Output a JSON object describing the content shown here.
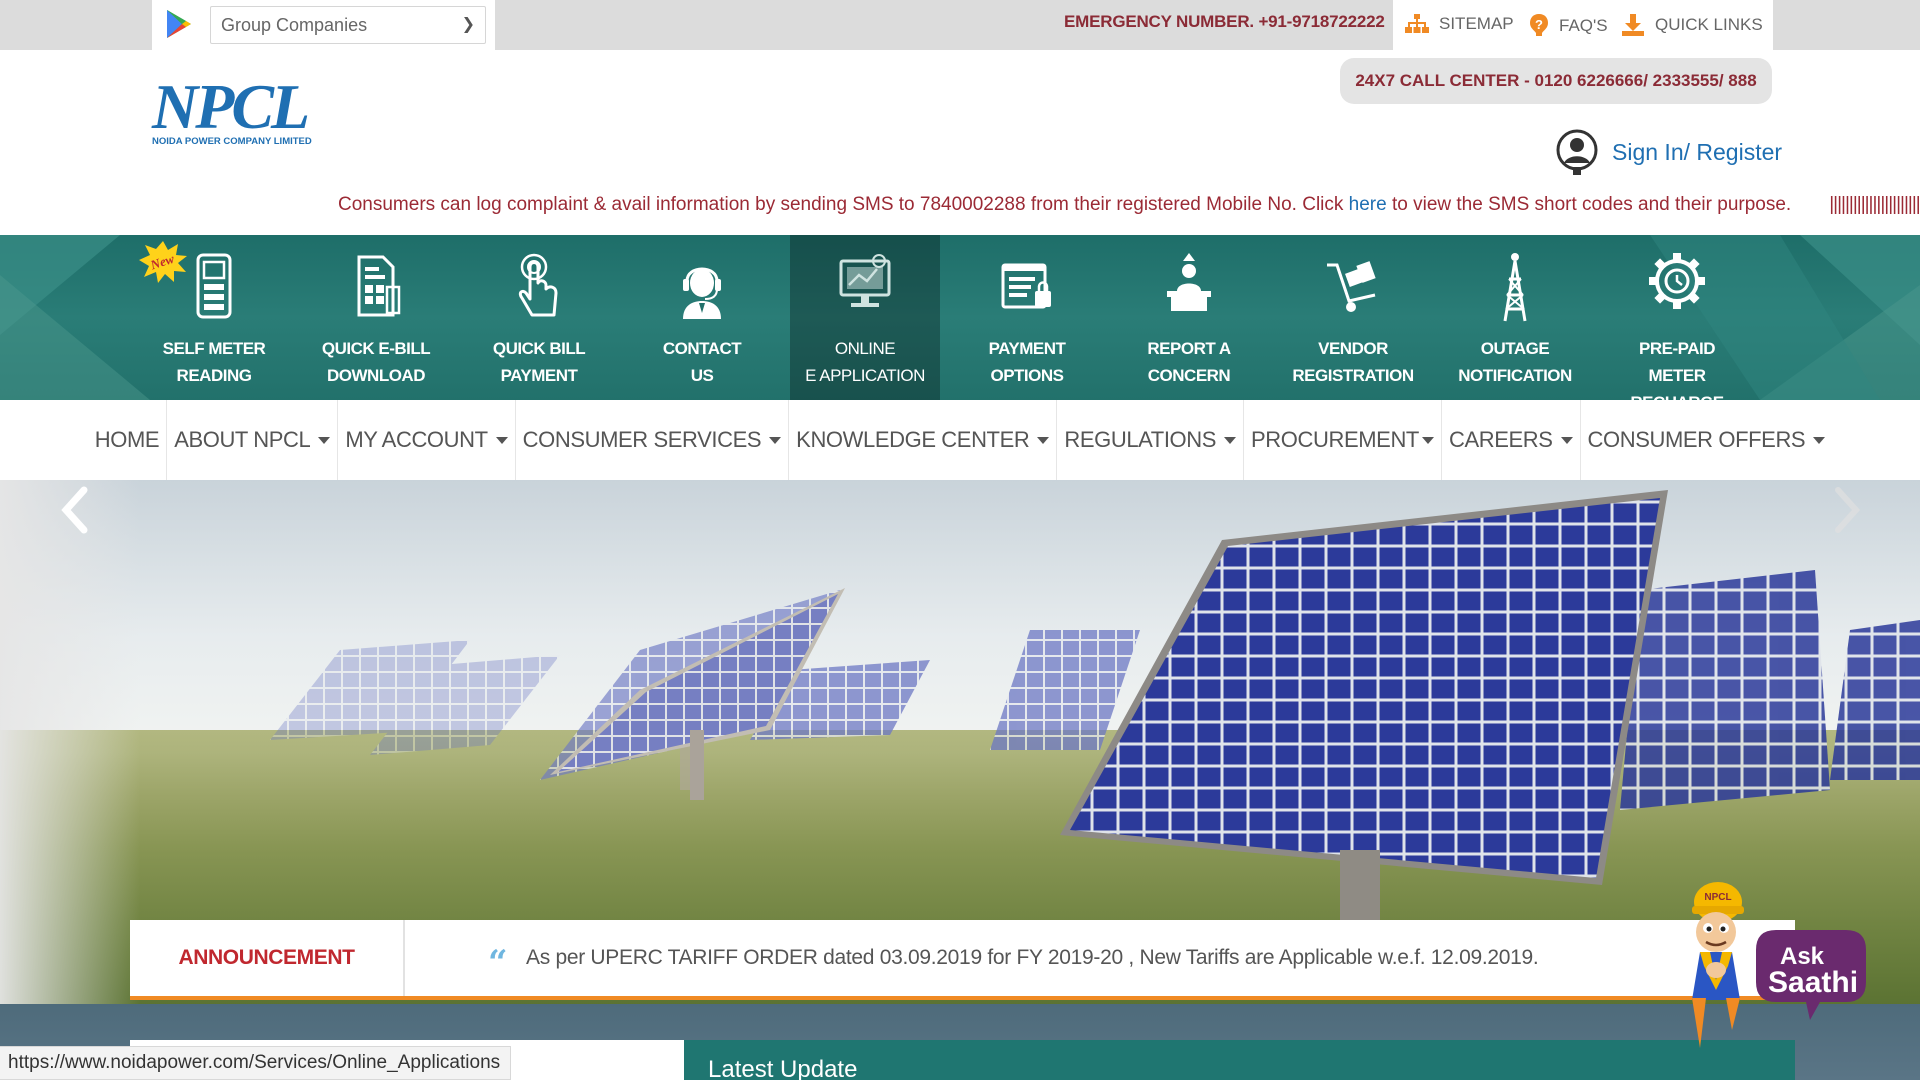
{
  "topbar": {
    "group_select": "Group Companies",
    "emergency": "EMERGENCY NUMBER. +91-9718722222",
    "links": [
      {
        "label": "SITEMAP",
        "icon": "sitemap-icon"
      },
      {
        "label": "FAQ'S",
        "icon": "faq-icon"
      },
      {
        "label": "QUICK LINKS",
        "icon": "download-icon"
      }
    ]
  },
  "header": {
    "logo_text": "NPCL",
    "logo_sub": "NOIDA POWER COMPANY LIMITED",
    "call_center": "24X7 CALL CENTER - 0120 6226666/ 2333555/ 888",
    "signin": "Sign In/ Register",
    "marquee_before": "Consumers can log complaint & avail information by sending SMS to 7840002288 from their registered Mobile No. Click ",
    "marquee_link": "here",
    "marquee_after": " to view the SMS short codes and their purpose.",
    "marquee_bars": "||||||||||||||||||||||||||||||||||||"
  },
  "quick_links": [
    {
      "line1": "SELF METER",
      "line2": "READING",
      "icon": "meter-icon"
    },
    {
      "line1": "QUICK E-BILL",
      "line2": "DOWNLOAD",
      "icon": "ebill-icon"
    },
    {
      "line1": "QUICK BILL",
      "line2": "PAYMENT",
      "icon": "hand-pointer-icon"
    },
    {
      "line1": "CONTACT",
      "line2": "US",
      "icon": "support-agent-icon"
    },
    {
      "line1": "ONLINE",
      "line2": "E APPLICATION",
      "icon": "monitor-icon"
    },
    {
      "line1": "PAYMENT",
      "line2": "OPTIONS",
      "icon": "payment-form-icon"
    },
    {
      "line1": "REPORT A",
      "line2": "CONCERN",
      "icon": "report-desk-icon"
    },
    {
      "line1": "VENDOR",
      "line2": "REGISTRATION",
      "icon": "cart-icon"
    },
    {
      "line1": "OUTAGE",
      "line2": "NOTIFICATION",
      "icon": "tower-icon"
    },
    {
      "line1": "PRE-PAID",
      "line2": "METER RECHARGE",
      "icon": "gear-icon"
    }
  ],
  "new_badge": "New",
  "nav": [
    {
      "label": "HOME",
      "dropdown": false
    },
    {
      "label": "ABOUT NPCL",
      "dropdown": true
    },
    {
      "label": "MY ACCOUNT",
      "dropdown": true
    },
    {
      "label": "CONSUMER SERVICES",
      "dropdown": true
    },
    {
      "label": "KNOWLEDGE CENTER",
      "dropdown": true
    },
    {
      "label": "REGULATIONS",
      "dropdown": true
    },
    {
      "label": "PROCUREMENT",
      "dropdown": true
    },
    {
      "label": "CAREERS",
      "dropdown": true
    },
    {
      "label": "CONSUMER OFFERS",
      "dropdown": true
    }
  ],
  "announcement": {
    "label": "ANNOUNCEMENT",
    "text": "As per UPERC TARIFF ORDER dated 03.09.2019 for FY 2019-20 , New Tariffs are Applicable w.e.f. 12.09.2019."
  },
  "latest_update": "Latest Update",
  "status_url": "https://www.noidapower.com/Services/Online_Applications",
  "saathi": {
    "line1": "Ask",
    "line2": "Saathi",
    "hat": "NPCL"
  },
  "colors": {
    "brand_blue": "#1f6fb2",
    "maroon": "#8b2b36",
    "teal": "#1f7671",
    "accent_orange": "#f08a24"
  }
}
